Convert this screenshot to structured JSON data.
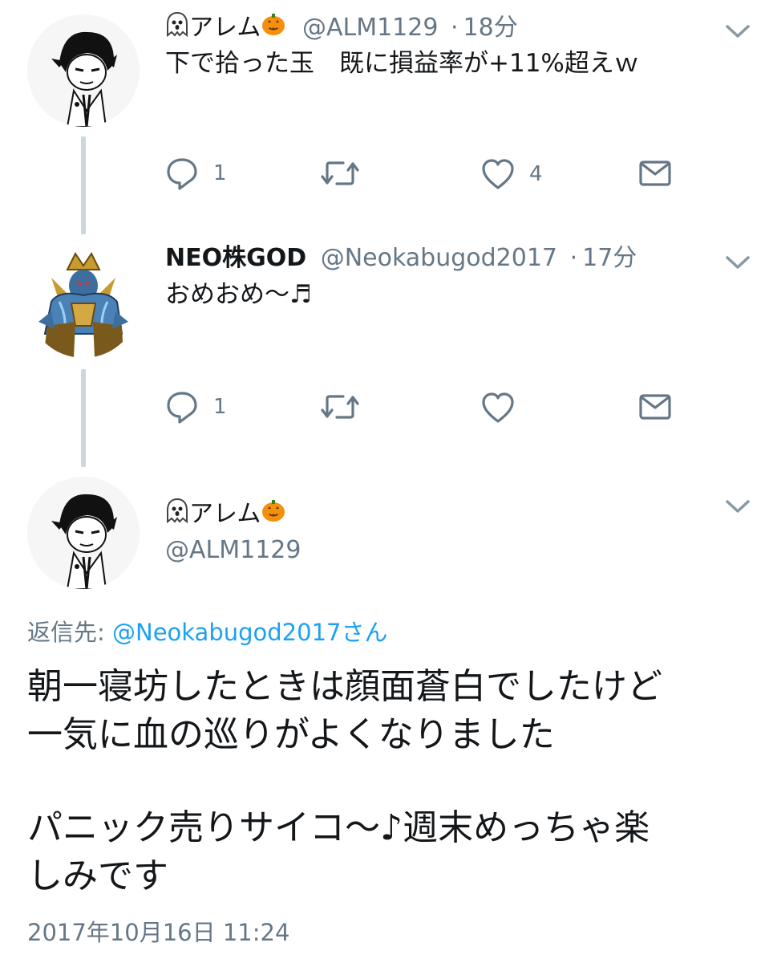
{
  "tweets": [
    {
      "display_name": "アレム",
      "handle": "@ALM1129",
      "separator": "·",
      "time": "18分",
      "text": "下で拾った玉　既に損益率が+11%超えｗ",
      "reply_count": "1",
      "retweet_count": "",
      "like_count": "4"
    },
    {
      "display_name": "NEO株GOD",
      "handle": "@Neokabugod2017",
      "separator": "·",
      "time": "17分",
      "text": "おめおめ～♬",
      "reply_count": "1",
      "retweet_count": "",
      "like_count": ""
    }
  ],
  "main_tweet": {
    "display_name": "アレム",
    "handle": "@ALM1129",
    "reply_prefix": "返信先:",
    "reply_mention": "@Neokabugod2017さん",
    "text_line_1": "朝一寝坊したときは顔面蒼白でしたけど",
    "text_line_2": "一気に血の巡りがよくなりました",
    "text_line_3": "パニック売りサイコ～♪週末めっちゃ楽",
    "text_line_4": "しみです",
    "timestamp": "2017年10月16日 11:24"
  },
  "icons": {
    "name_prefix": "ghost-icon",
    "name_suffix": "jack-o-lantern-icon",
    "reply": "reply-icon",
    "retweet": "retweet-icon",
    "like": "heart-icon",
    "dm": "envelope-icon",
    "menu": "chevron-down-icon"
  },
  "colors": {
    "text": "#14171a",
    "secondary": "#657786",
    "link": "#1da1f2",
    "thread_line": "#ccd6dd"
  }
}
